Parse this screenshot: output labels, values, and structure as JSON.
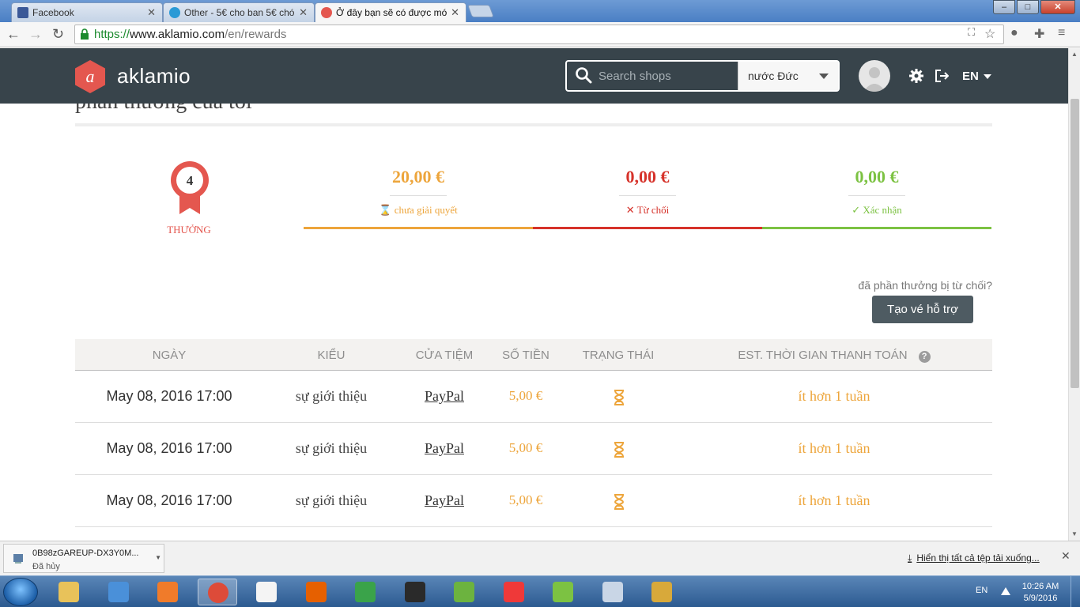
{
  "browser": {
    "tabs": [
      {
        "label": "Facebook",
        "favicon_color": "#3b5998"
      },
      {
        "label": "Other - 5€ cho ban 5€ chó",
        "favicon_color": "#2a9ad6"
      },
      {
        "label": "Ở đây bạn sẽ có được mó",
        "favicon_color": "#e4574f"
      }
    ],
    "url_scheme": "https://",
    "url_host": "www.aklamio.com",
    "url_path": "/en/rewards",
    "window_min": "–",
    "window_max": "□",
    "window_close": "✕"
  },
  "header": {
    "logo_letter": "a",
    "brand": "aklamio",
    "search_placeholder": "Search shops",
    "country": "nước Đức",
    "lang": "EN",
    "accent": "#e4574f",
    "bg": "#38444b"
  },
  "page": {
    "title": "phần thưởng của tôi",
    "rewards_count": "4",
    "rewards_label": "THƯỞNG",
    "stats": [
      {
        "amount": "20,00 €",
        "icon": "⌛",
        "label": "chưa giải quyết",
        "color": "#eda53b"
      },
      {
        "amount": "0,00 €",
        "icon": "✕",
        "label": "Từ chối",
        "color": "#d6322a"
      },
      {
        "amount": "0,00 €",
        "icon": "✓",
        "label": "Xác nhận",
        "color": "#7cc242"
      }
    ],
    "rejected_question": "đã phần thưởng bị từ chối?",
    "support_button": "Tạo vé hỗ trợ"
  },
  "table": {
    "headers": {
      "date": "NGÀY",
      "type": "KIỂU",
      "shop": "CỬA TIỆM",
      "amount": "SỐ TIỀN",
      "status": "TRẠNG THÁI",
      "est": "EST. THỜI GIAN THANH TOÁN",
      "help": "?"
    },
    "rows": [
      {
        "date": "May 08, 2016 17:00",
        "type": "sự giới thiệu",
        "shop": "PayPal",
        "amount": "5,00 €",
        "status_icon": "hourglass",
        "est": "ít hơn 1 tuần"
      },
      {
        "date": "May 08, 2016 17:00",
        "type": "sự giới thiệu",
        "shop": "PayPal",
        "amount": "5,00 €",
        "status_icon": "hourglass",
        "est": "ít hơn 1 tuần"
      },
      {
        "date": "May 08, 2016 17:00",
        "type": "sự giới thiệu",
        "shop": "PayPal",
        "amount": "5,00 €",
        "status_icon": "hourglass",
        "est": "ít hơn 1 tuần"
      }
    ]
  },
  "downloads": {
    "file_name": "0B98zGAREUP-DX3Y0M...",
    "file_status": "Đã hủy",
    "show_all": "Hiển thị tất cả tệp tải xuống..."
  },
  "taskbar": {
    "lang": "EN",
    "time": "10:26 AM",
    "date": "5/9/2016",
    "apps": [
      "explorer-icon",
      "media-player-icon",
      "uc-browser-icon",
      "chrome-icon",
      "unikey-icon",
      "firefox-icon",
      "idm-icon",
      "potplayer-icon",
      "bluestacks-icon",
      "vivaldi-icon",
      "coccoc-icon",
      "phone-icon",
      "database-icon"
    ]
  }
}
